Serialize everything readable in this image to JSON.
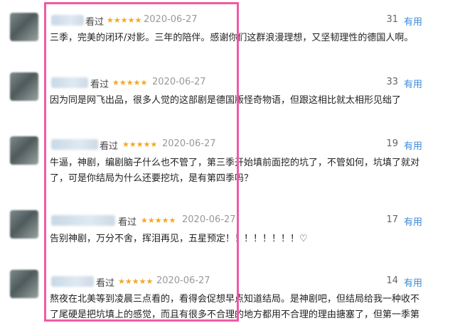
{
  "comments": [
    {
      "seen": "看过",
      "stars": "★★★★★",
      "date": "2020-06-27",
      "votes": "31",
      "useful": "有用",
      "text": "三季，完美的闭环/对影。三年的陪伴。感谢你们这群浪漫理想，又坚韧理性的德国人啊。"
    },
    {
      "seen": "看过",
      "stars": "★★★★★",
      "date": "2020-06-27",
      "votes": "33",
      "useful": "有用",
      "text": "因为同是网飞出品，很多人觉的这部剧是德国版怪奇物语，但跟这相比就太相形见绌了"
    },
    {
      "seen": "看过",
      "stars": "★★★★★",
      "date": "2020-06-27",
      "votes": "19",
      "useful": "有用",
      "text": "牛逼，神剧，编剧脑子什么也不管了，第三季开始填前面挖的坑了，不管如何，坑填了就对",
      "text2": "了，可是你结局为什么还要挖坑，是有第四季吗？"
    },
    {
      "seen": "看过",
      "stars": "★★★★★",
      "date": "2020-06-27",
      "votes": "17",
      "useful": "有用",
      "text": "告别神剧，万分不舍，挥泪再见，五星预定！！！！！！！！♡"
    },
    {
      "seen": "看过",
      "stars": "★★★★★",
      "date": "2020-06-27",
      "votes": "14",
      "useful": "有用",
      "text": "熬夜在北美等到凌晨三点看的，看得会促想早点知道结局。是神剧吧，但结局给我一种收不",
      "text2": "了尾硬是把坑填上的感觉，而且有很多不合理的地方都用不合理的理由搪塞了，但第一季第"
    }
  ]
}
